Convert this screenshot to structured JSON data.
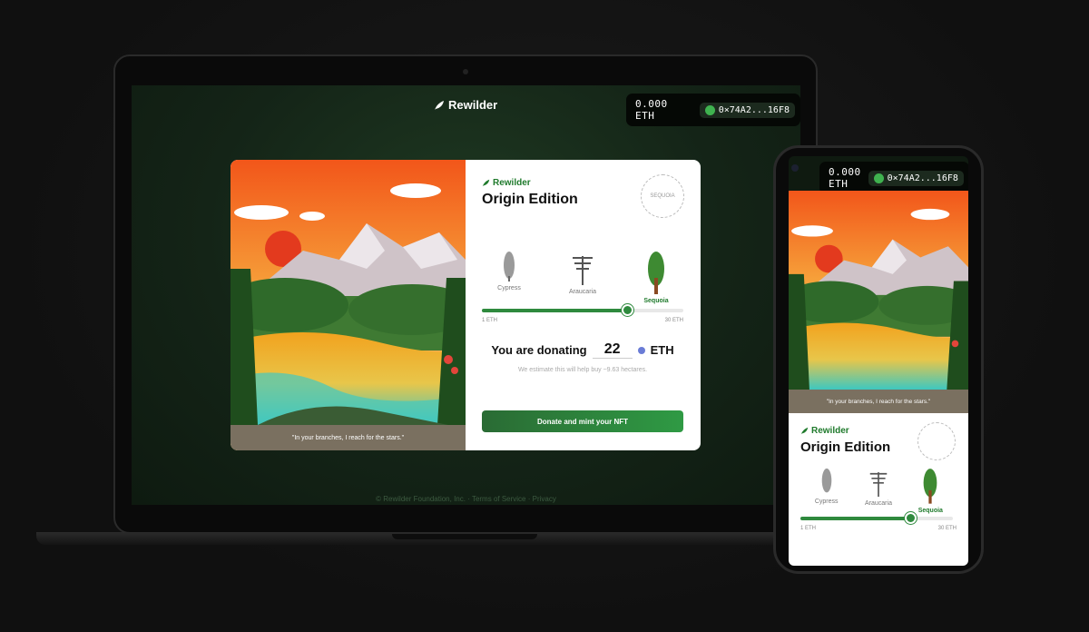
{
  "app": {
    "name": "Rewilder"
  },
  "wallet": {
    "balance": "0.000 ETH",
    "address": "0×74A2...16F8"
  },
  "nft": {
    "edition_title": "Origin Edition",
    "caption": "\"In your branches, I reach for the stars.\"",
    "stamp_text": "SEQUOIA"
  },
  "trees": [
    {
      "name": "Cypress",
      "active": false
    },
    {
      "name": "Araucaria",
      "active": false
    },
    {
      "name": "Sequoia",
      "active": true
    }
  ],
  "slider": {
    "min_label": "1 ETH",
    "max_label": "30 ETH",
    "level": 0.72
  },
  "donation": {
    "prefix": "You are donating",
    "amount": "22",
    "currency": "ETH",
    "estimate": "We estimate this will help buy ~9.63 hectares.",
    "cta_label": "Donate and mint your NFT"
  },
  "footer": {
    "text": "© Rewilder Foundation, Inc. · Terms of Service · Privacy"
  },
  "colors": {
    "brand_green": "#2f8a3e",
    "sky_orange": "#f07a1a",
    "sun_red": "#e33a1e"
  }
}
